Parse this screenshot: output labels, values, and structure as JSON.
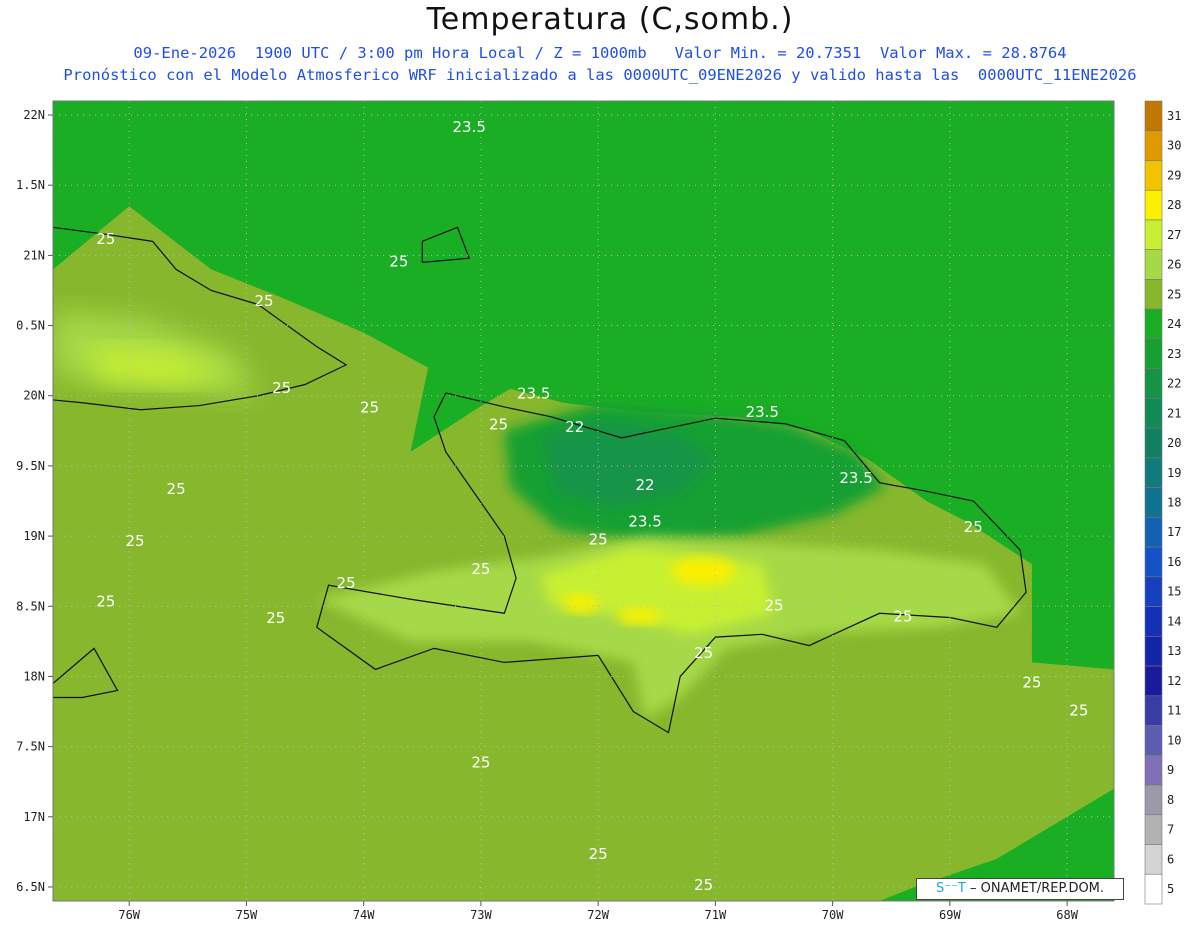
{
  "header": {
    "title": "Temperatura (C,somb.)",
    "line1": "09-Ene-2026  1900 UTC / 3:00 pm Hora Local / Z = 1000mb   Valor Min. = 20.7351  Valor Max. = 28.8764",
    "line2": "Pronóstico con el Modelo Atmosferico WRF inicializado a las 0000UTC_09ENE2026 y valido hasta las  0000UTC_11ENE2026"
  },
  "credit": {
    "logo": "S⁻⁻T",
    "text": "– ONAMET/REP.DOM."
  },
  "chart_data": {
    "type": "heatmap",
    "title": "Temperatura (C,somb.)",
    "variable": "Temperatura",
    "unit": "C",
    "level": "Z = 1000mb",
    "valid_time": "09-Ene-2026 1900 UTC / 3:00 pm Hora Local",
    "value_min": 20.7351,
    "value_max": 28.8764,
    "grid": true,
    "x_ticks": [
      "76W",
      "75W",
      "74W",
      "73W",
      "72W",
      "71W",
      "70W",
      "69W",
      "68W"
    ],
    "x_values": [
      -76,
      -75,
      -74,
      -73,
      -72,
      -71,
      -70,
      -69,
      -68
    ],
    "y_ticks": [
      "22N",
      "1.5N",
      "21N",
      "0.5N",
      "20N",
      "9.5N",
      "19N",
      "8.5N",
      "18N",
      "7.5N",
      "17N",
      "6.5N"
    ],
    "y_values": [
      22,
      21.5,
      21,
      20.5,
      20,
      19.5,
      19,
      18.5,
      18,
      17.5,
      17,
      16.5
    ],
    "xlim": [
      -76.65,
      -67.6
    ],
    "ylim": [
      16.4,
      22.1
    ],
    "colorbar": {
      "levels": [
        31,
        30,
        29,
        28,
        27,
        26,
        25,
        24,
        23,
        22,
        21,
        20,
        19,
        18,
        17,
        16,
        15,
        14,
        13,
        12,
        11,
        10,
        9,
        8,
        7,
        6,
        5
      ],
      "colors": [
        "#c07800",
        "#e09a00",
        "#f2c400",
        "#faf000",
        "#c8f032",
        "#a6d946",
        "#86b72d",
        "#19ae23",
        "#16a032",
        "#149446",
        "#128a56",
        "#118062",
        "#117a7a",
        "#0f7290",
        "#1262b4",
        "#1452c8",
        "#1640c0",
        "#1430b4",
        "#1224a8",
        "#1a1a9c",
        "#3a3ca6",
        "#5c5cb0",
        "#8070b8",
        "#9a9aa8",
        "#b2b2b2",
        "#d4d4d4",
        "#ffffff"
      ]
    },
    "contour_labels": [
      {
        "text": "23.5",
        "lon": -73.1,
        "lat": 21.88
      },
      {
        "text": "25",
        "lon": -73.7,
        "lat": 20.92
      },
      {
        "text": "25",
        "lon": -76.2,
        "lat": 21.08
      },
      {
        "text": "25",
        "lon": -74.85,
        "lat": 20.64
      },
      {
        "text": "25",
        "lon": -74.7,
        "lat": 20.02
      },
      {
        "text": "25",
        "lon": -73.95,
        "lat": 19.88
      },
      {
        "text": "23.5",
        "lon": -72.55,
        "lat": 19.98
      },
      {
        "text": "25",
        "lon": -72.85,
        "lat": 19.76
      },
      {
        "text": "22",
        "lon": -72.2,
        "lat": 19.74
      },
      {
        "text": "23.5",
        "lon": -70.6,
        "lat": 19.85
      },
      {
        "text": "22",
        "lon": -71.6,
        "lat": 19.33
      },
      {
        "text": "23.5",
        "lon": -69.8,
        "lat": 19.38
      },
      {
        "text": "25",
        "lon": -75.6,
        "lat": 19.3
      },
      {
        "text": "25",
        "lon": -75.95,
        "lat": 18.93
      },
      {
        "text": "23.5",
        "lon": -71.6,
        "lat": 19.07
      },
      {
        "text": "25",
        "lon": -72.0,
        "lat": 18.94
      },
      {
        "text": "25",
        "lon": -68.8,
        "lat": 19.03
      },
      {
        "text": "25",
        "lon": -73.0,
        "lat": 18.73
      },
      {
        "text": "25",
        "lon": -74.15,
        "lat": 18.63
      },
      {
        "text": "25",
        "lon": -76.2,
        "lat": 18.5
      },
      {
        "text": "25",
        "lon": -74.75,
        "lat": 18.38
      },
      {
        "text": "25",
        "lon": -70.5,
        "lat": 18.47
      },
      {
        "text": "25",
        "lon": -69.4,
        "lat": 18.39
      },
      {
        "text": "25",
        "lon": -71.1,
        "lat": 18.13
      },
      {
        "text": "25",
        "lon": -68.3,
        "lat": 17.92
      },
      {
        "text": "25",
        "lon": -67.9,
        "lat": 17.72
      },
      {
        "text": "25",
        "lon": -73.0,
        "lat": 17.35
      },
      {
        "text": "25",
        "lon": -72.0,
        "lat": 16.7
      },
      {
        "text": "25",
        "lon": -71.1,
        "lat": 16.48
      }
    ]
  }
}
